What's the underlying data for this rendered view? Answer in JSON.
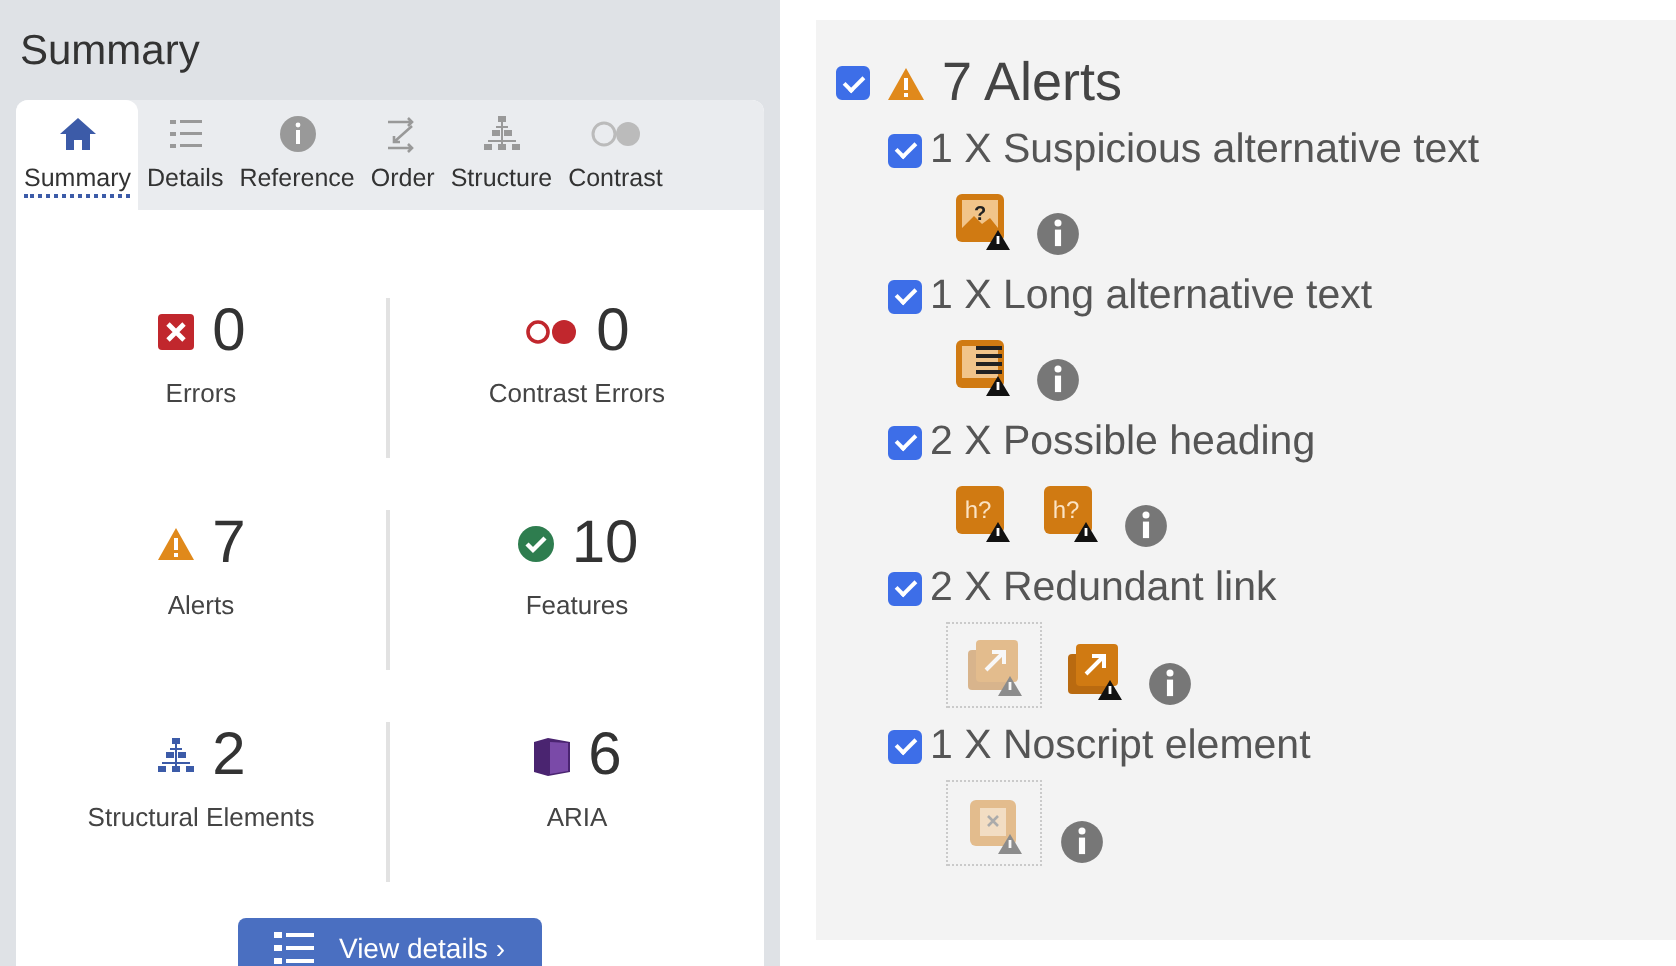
{
  "summary": {
    "title": "Summary",
    "tabs": [
      {
        "kind": "home",
        "label": "Summary",
        "selected": true
      },
      {
        "kind": "list",
        "label": "Details",
        "selected": false
      },
      {
        "kind": "info",
        "label": "Reference",
        "selected": false
      },
      {
        "kind": "order",
        "label": "Order",
        "selected": false
      },
      {
        "kind": "structure",
        "label": "Structure",
        "selected": false
      },
      {
        "kind": "contrast",
        "label": "Contrast",
        "selected": false
      }
    ],
    "stats": [
      {
        "kind": "error",
        "count": "0",
        "label": "Errors"
      },
      {
        "kind": "contrast",
        "count": "0",
        "label": "Contrast Errors"
      },
      {
        "kind": "alert",
        "count": "7",
        "label": "Alerts"
      },
      {
        "kind": "feature",
        "count": "10",
        "label": "Features"
      },
      {
        "kind": "structure",
        "count": "2",
        "label": "Structural Elements"
      },
      {
        "kind": "aria",
        "count": "6",
        "label": "ARIA"
      }
    ],
    "button": "View details ›"
  },
  "alerts": {
    "title": "7 Alerts",
    "checked": true,
    "items": [
      {
        "label": "1 X Suspicious alternative text",
        "checked": true,
        "icons": [
          {
            "kind": "image",
            "glyph": "?",
            "dimmed": false
          }
        ]
      },
      {
        "label": "1 X Long alternative text",
        "checked": true,
        "icons": [
          {
            "kind": "longtext",
            "dimmed": false
          }
        ]
      },
      {
        "label": "2 X Possible heading",
        "checked": true,
        "icons": [
          {
            "kind": "heading",
            "glyph": "h?",
            "dimmed": false
          },
          {
            "kind": "heading",
            "glyph": "h?",
            "dimmed": false
          }
        ]
      },
      {
        "label": "2 X Redundant link",
        "checked": true,
        "icons": [
          {
            "kind": "link",
            "dimmed": true
          },
          {
            "kind": "link",
            "dimmed": false
          }
        ]
      },
      {
        "label": "1 X Noscript element",
        "checked": true,
        "icons": [
          {
            "kind": "noscript",
            "dimmed": true
          }
        ]
      }
    ]
  }
}
